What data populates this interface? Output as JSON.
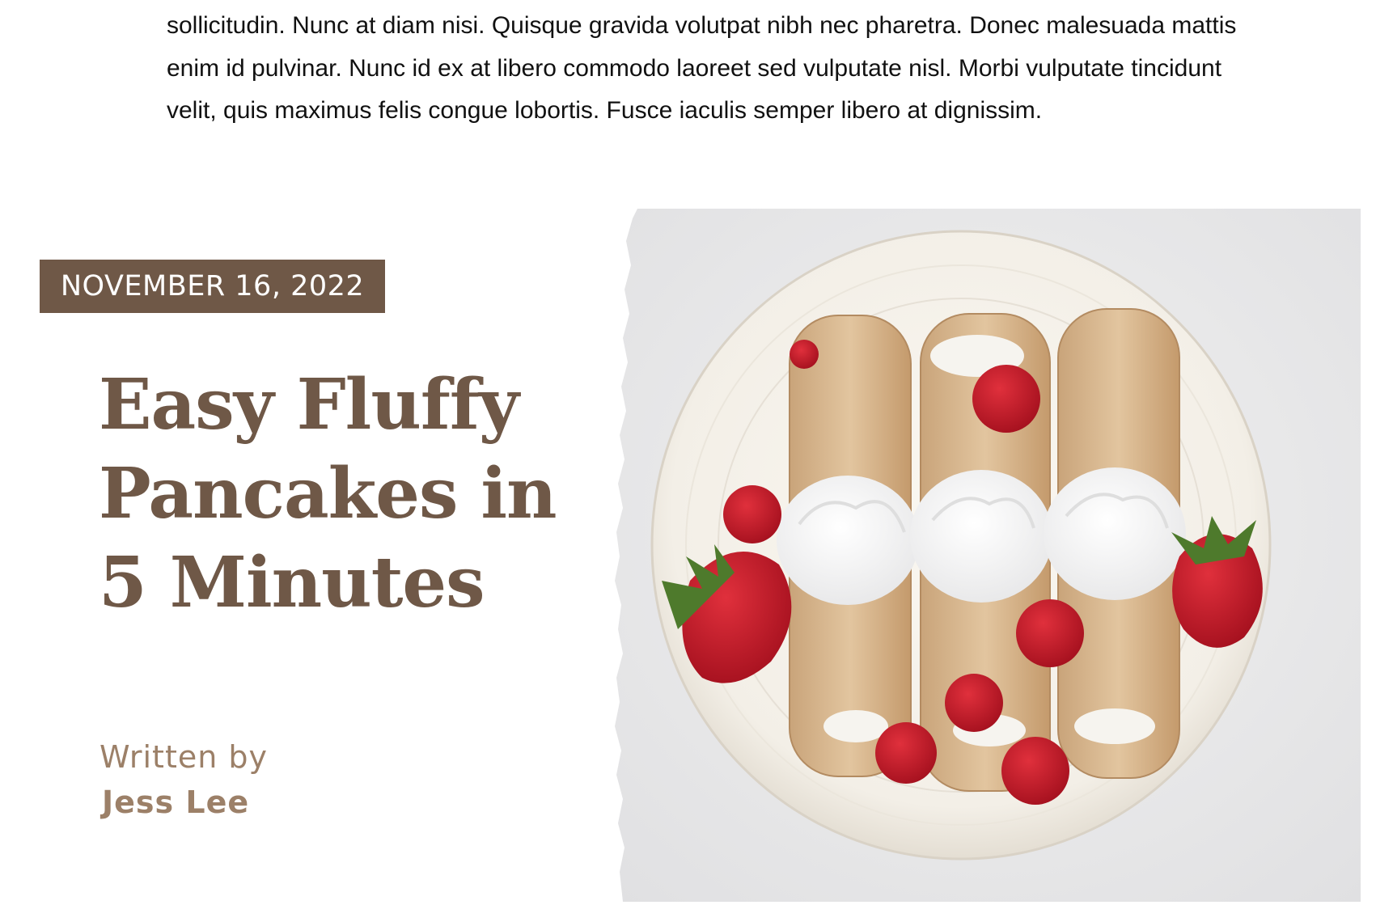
{
  "article": {
    "intro_text": "sollicitudin. Nunc at diam nisi. Quisque gravida volutpat nibh nec pharetra. Donec malesuada mattis enim id pulvinar. Nunc id ex at libero commodo laoreet sed vulputate nisl. Morbi vulputate tincidunt velit, quis maximus felis congue lobortis. Fusce iaculis semper libero at dignissim."
  },
  "post": {
    "date": "NOVEMBER 16, 2022",
    "title": "Easy Fluffy Pancakes in 5 Minutes",
    "written_by_label": "Written by",
    "author": "Jess Lee"
  },
  "image": {
    "icon": "crepes-with-strawberries-photo"
  },
  "colors": {
    "brand_brown": "#6f5847",
    "author_tan": "#9c8068",
    "body_text": "#111111",
    "background": "#ffffff"
  }
}
